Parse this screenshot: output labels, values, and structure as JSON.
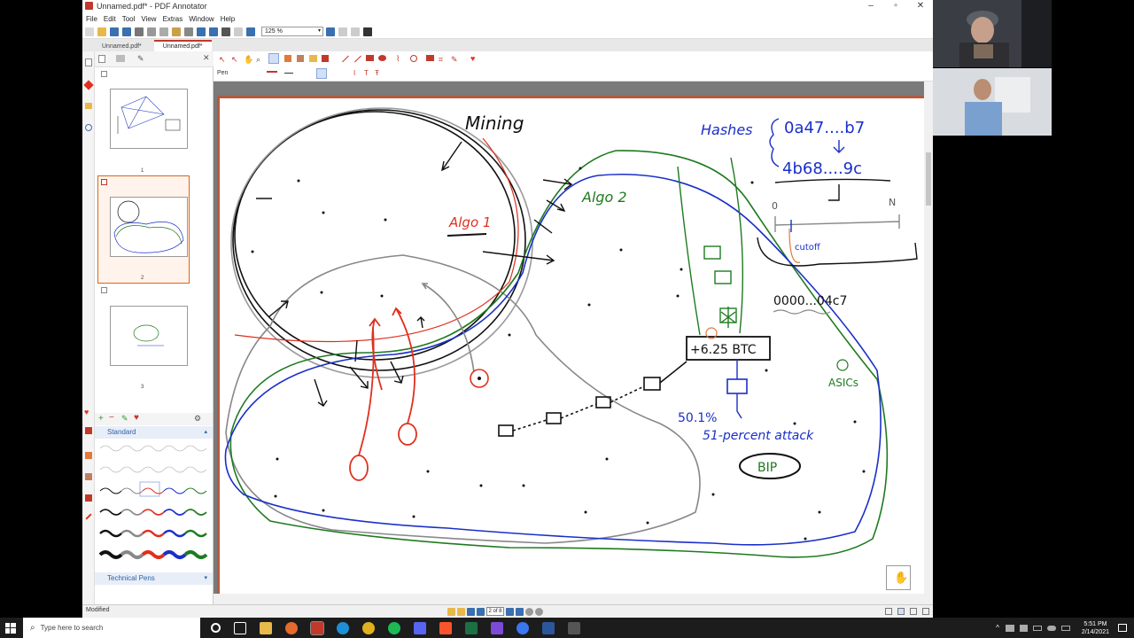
{
  "app": {
    "window_title": "Unnamed.pdf* - PDF Annotator",
    "menu": [
      "File",
      "Edit",
      "Tool",
      "View",
      "Extras",
      "Window",
      "Help"
    ],
    "zoom": "125 %",
    "tabs": [
      "Unnamed.pdf*",
      "Unnamed.pdf*"
    ],
    "tool_label": "Pen",
    "status": "Modified",
    "page_indicator": "2 of 8"
  },
  "sidebar": {
    "thumbnails": [
      "1",
      "2",
      "3"
    ],
    "pens_title": "Standard",
    "tech_pens_title": "Technical Pens"
  },
  "drawing": {
    "mining": "Mining",
    "algo1": "Algo 1",
    "algo2": "Algo 2",
    "hashes": "Hashes",
    "hash1": "0a47....b7",
    "hash2": "4b68....9c",
    "zero": "0",
    "n": "N",
    "cutoff": "cutoff",
    "hash3": "0000...04c7",
    "reward": "+6.25 BTC",
    "asics": "ASICs",
    "pct": "50.1%",
    "attack": "51-percent attack",
    "bip": "BIP"
  },
  "taskbar": {
    "search_placeholder": "Type here to search",
    "time": "5:51 PM",
    "date": "2/14/2021"
  },
  "colors": {
    "accent": "#c0392b",
    "ink_black": "#111111",
    "ink_red": "#e0301e",
    "ink_green": "#1f7a1f",
    "ink_blue": "#1a2fc8",
    "ink_gray": "#888888"
  }
}
